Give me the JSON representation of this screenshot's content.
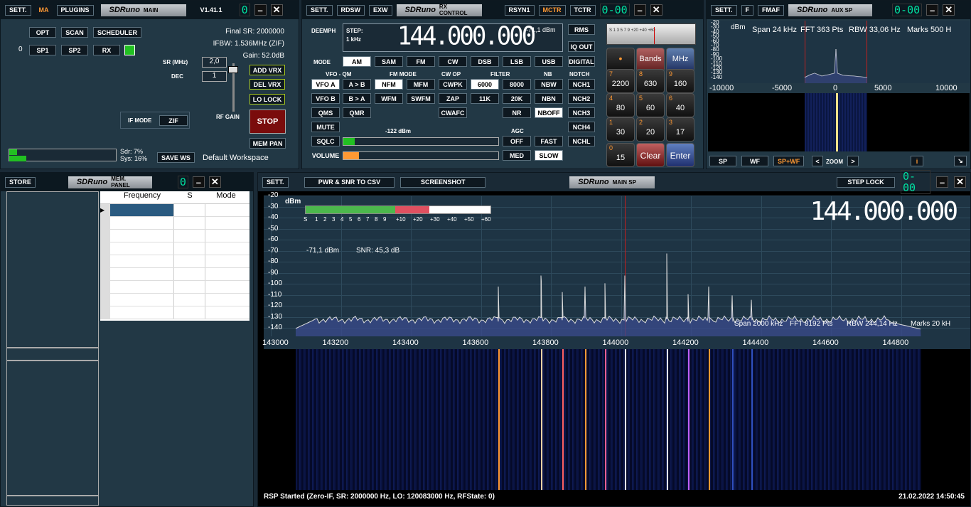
{
  "main": {
    "sett": "SETT.",
    "ma": "MA",
    "plugins": "PLUGINS",
    "title_logo": "SDRuno",
    "title": "MAIN",
    "version": "V1.41.1",
    "digit": "0",
    "opt": "OPT",
    "scan": "SCAN",
    "scheduler": "SCHEDULER",
    "zero": "0",
    "sp1": "SP1",
    "sp2": "SP2",
    "rx": "RX",
    "final_sr": "Final SR: 2000000",
    "ifbw": "IFBW: 1.536MHz (ZIF)",
    "gain": "Gain: 52.0dB",
    "sr_label": "SR (MHz)",
    "sr_value": "2,0",
    "dec_label": "DEC",
    "dec_value": "1",
    "add_vrx": "ADD VRX",
    "del_vrx": "DEL VRX",
    "lo_lock": "LO LOCK",
    "if_mode": "IF MODE",
    "zif": "ZIF",
    "rf_gain": "RF GAIN",
    "stop": "STOP",
    "sdr": "Sdr: 7%",
    "sys": "Sys: 16%",
    "save_ws": "SAVE WS",
    "workspace": "Default Workspace",
    "mem_pan": "MEM PAN"
  },
  "rx": {
    "sett": "SETT.",
    "rdsw": "RDSW",
    "exw": "EXW",
    "title_logo": "SDRuno",
    "title": "RX CONTROL",
    "rsyn1": "RSYN1",
    "mctr": "MCTR",
    "tctr": "TCTR",
    "digit": "0-00",
    "deemph": "DEEMPH",
    "step": "STEP:",
    "step_val": "1 kHz",
    "freq": "144.000.000",
    "dbm": "-71,1 dBm",
    "rms": "RMS",
    "iq_out": "IQ OUT",
    "mode_label": "MODE",
    "modes": [
      "AM",
      "SAM",
      "FM",
      "CW",
      "DSB",
      "LSB",
      "USB",
      "DIGITAL"
    ],
    "vfo_qm": "VFO - QM",
    "fm_mode": "FM MODE",
    "cw_op": "CW OP",
    "filter": "FILTER",
    "nb": "NB",
    "notch": "NOTCH",
    "vfo_a": "VFO A",
    "a_b": "A > B",
    "nfm": "NFM",
    "mfm": "MFM",
    "cwpk": "CWPK",
    "f6000": "6000",
    "f8000": "8000",
    "nbw": "NBW",
    "nch1": "NCH1",
    "vfo_b": "VFO B",
    "b_a": "B > A",
    "wfm": "WFM",
    "swfm": "SWFM",
    "zap": "ZAP",
    "f11k": "11K",
    "f20k": "20K",
    "nbn": "NBN",
    "nch2": "NCH2",
    "qms": "QMS",
    "qmr": "QMR",
    "cwafc": "CWAFC",
    "nr": "NR",
    "nboff": "NBOFF",
    "nch3": "NCH3",
    "mute": "MUTE",
    "sq_db": "-122 dBm",
    "agc": "AGC",
    "nch4": "NCH4",
    "sqlc": "SQLC",
    "off": "OFF",
    "fast": "FAST",
    "nchl": "NCHL",
    "volume": "VOLUME",
    "med": "MED",
    "slow": "SLOW",
    "keys": [
      {
        "n": "7",
        "v": "2200"
      },
      {
        "n": "8",
        "v": "630"
      },
      {
        "n": "9",
        "v": "160"
      },
      {
        "n": "4",
        "v": "80"
      },
      {
        "n": "5",
        "v": "60"
      },
      {
        "n": "6",
        "v": "40"
      },
      {
        "n": "1",
        "v": "30"
      },
      {
        "n": "2",
        "v": "20"
      },
      {
        "n": "3",
        "v": "17"
      }
    ],
    "key0": {
      "n": "0",
      "v": "15"
    },
    "bands": "Bands",
    "mhz": "MHz",
    "clear": "Clear",
    "enter": "Enter",
    "smeter_scale": "S 1 3 5 7 9 +20 +40 +60"
  },
  "aux": {
    "sett": "SETT.",
    "f": "F",
    "fmaf": "FMAF",
    "title_logo": "SDRuno",
    "title": "AUX SP",
    "digit": "0-00",
    "dbm": "dBm",
    "span": "Span 24 kHz",
    "fft": "FFT 363 Pts",
    "rbw": "RBW 33,06 Hz",
    "marks": "Marks 500 H",
    "yticks": [
      "-20",
      "-30",
      "-40",
      "-50",
      "-60",
      "-70",
      "-80",
      "-90",
      "-100",
      "-110",
      "-120",
      "-130",
      "-140"
    ],
    "xticks": [
      "-10000",
      "-5000",
      "0",
      "5000",
      "10000"
    ],
    "sp": "SP",
    "wf": "WF",
    "spwf": "SP+WF",
    "zoom": "ZOOM",
    "i": "i"
  },
  "mem": {
    "store": "STORE",
    "title_logo": "SDRuno",
    "title": "MEM. PANEL",
    "digit": "0",
    "cols": [
      "Frequency",
      "S",
      "Mode"
    ]
  },
  "mainsp": {
    "sett": "SETT.",
    "pwr": "PWR & SNR TO CSV",
    "screenshot": "SCREENSHOT",
    "title_logo": "SDRuno",
    "title": "MAIN SP",
    "step_lock": "STEP LOCK",
    "digit": "0-00",
    "freq": "144.000.000",
    "dbm": "dBm",
    "level": "-71,1 dBm",
    "snr": "SNR: 45,3 dB",
    "yticks": [
      "-20",
      "-30",
      "-40",
      "-50",
      "-60",
      "-70",
      "-80",
      "-90",
      "-100",
      "-110",
      "-120",
      "-130",
      "-140"
    ],
    "xticks": [
      "143000",
      "143200",
      "143400",
      "143600",
      "143800",
      "144000",
      "144200",
      "144400",
      "144600",
      "144800"
    ],
    "smeter_labels": [
      "S",
      "1",
      "2",
      "3",
      "4",
      "5",
      "6",
      "7",
      "8",
      "9",
      "+10",
      "+20",
      "+30",
      "+40",
      "+50",
      "+60"
    ],
    "span": "Span 2000 kHz",
    "fft": "FFT 8192 Pts",
    "rbw": "RBW 244,14 Hz",
    "marks": "Marks 20 kH",
    "status": "RSP Started (Zero-IF, SR: 2000000 Hz, LO: 120083000 Hz, RFState: 0)",
    "datetime": "21.02.2022 14:50:45"
  }
}
